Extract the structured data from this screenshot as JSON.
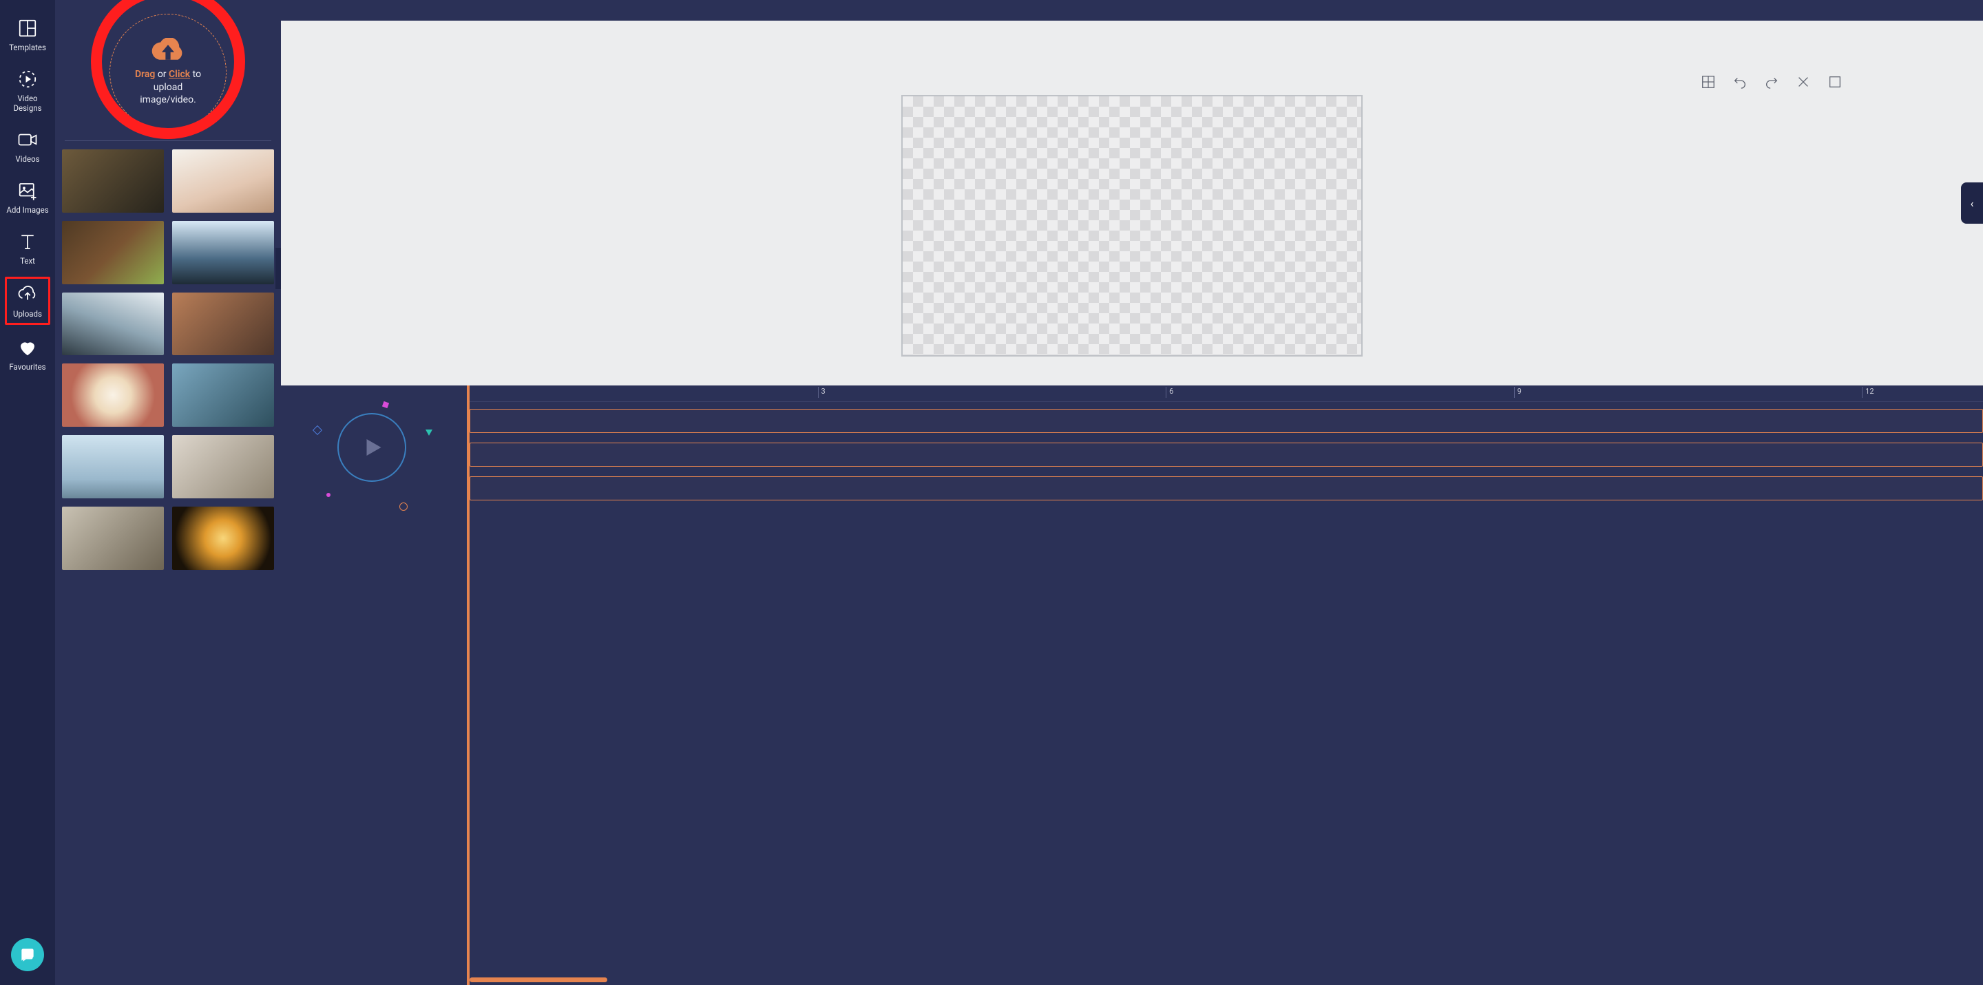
{
  "nav": {
    "items": [
      {
        "id": "templates",
        "label": "Templates",
        "icon": "templates-icon"
      },
      {
        "id": "video-designs",
        "label": "Video Designs",
        "icon": "video-designs-icon"
      },
      {
        "id": "videos",
        "label": "Videos",
        "icon": "videos-icon"
      },
      {
        "id": "add-images",
        "label": "Add Images",
        "icon": "add-images-icon"
      },
      {
        "id": "text",
        "label": "Text",
        "icon": "text-icon"
      },
      {
        "id": "uploads",
        "label": "Uploads",
        "icon": "uploads-icon",
        "active": true
      },
      {
        "id": "favourites",
        "label": "Favourites",
        "icon": "favourites-icon"
      }
    ]
  },
  "dropzone": {
    "word_drag": "Drag",
    "word_or": " or ",
    "word_click": "Click",
    "word_to": " to",
    "line2": "upload",
    "line3": "image/video."
  },
  "thumbnails": [
    {
      "id": "t1",
      "bg": "linear-gradient(135deg,#6d5a3c 0%,#27241c 100%)"
    },
    {
      "id": "t2",
      "bg": "linear-gradient(160deg,#f5f2ec 0%,#e3c7b2 60%,#bd997c 100%)"
    },
    {
      "id": "t3",
      "bg": "linear-gradient(135deg,#4f3a24 0%,#7a5432 50%,#8fae4f 100%)"
    },
    {
      "id": "t4",
      "bg": "linear-gradient(180deg,#d7e8f5 0%,#4a6a84 60%,#1e2b36 100%)"
    },
    {
      "id": "t5",
      "bg": "linear-gradient(200deg,#e8eef2 0%,#8fa6b4 50%,#2e3a42 100%)"
    },
    {
      "id": "t6",
      "bg": "linear-gradient(135deg,#b97e58 0%,#4f372a 100%)"
    },
    {
      "id": "t7",
      "bg": "radial-gradient(circle at 50% 50%,#f9f2e6 0%,#eedabc 30%,#bb6857 70%)"
    },
    {
      "id": "t8",
      "bg": "linear-gradient(135deg,#7aa7bf 0%,#2e4f5e 100%)"
    },
    {
      "id": "t9",
      "bg": "linear-gradient(180deg,#cfe3ef 0%,#9ab8cc 70%,#6b889a 100%)"
    },
    {
      "id": "t10",
      "bg": "linear-gradient(135deg,#ded7cd 0%,#8f8573 100%)"
    },
    {
      "id": "t11",
      "bg": "linear-gradient(135deg,#c9c2b3 0%,#6e6554 100%)"
    },
    {
      "id": "t12",
      "bg": "radial-gradient(circle at 50% 50%,#f8d67a 0%,#e09a2e 30%,#1a1208 80%)"
    }
  ],
  "panel": {
    "collapse_glyph": "‹"
  },
  "right_tab": {
    "glyph": "‹"
  },
  "toolbar": {
    "grid": "Grid",
    "undo": "Undo",
    "redo": "Redo",
    "close": "Close",
    "fs": "Fullscreen"
  },
  "timeline": {
    "markers": [
      {
        "label": "3",
        "pct": 23
      },
      {
        "label": "6",
        "pct": 46
      },
      {
        "label": "9",
        "pct": 69
      },
      {
        "label": "12",
        "pct": 92
      }
    ],
    "tracks": [
      1,
      2,
      3
    ]
  }
}
